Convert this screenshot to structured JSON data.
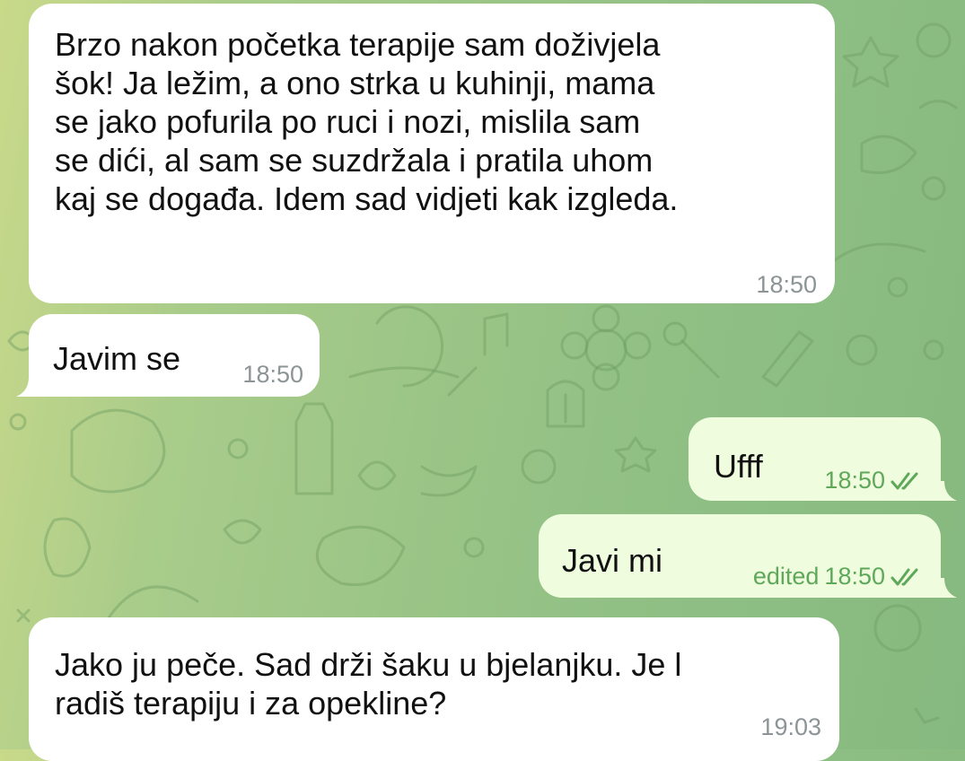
{
  "messages": [
    {
      "direction": "incoming",
      "text": "Brzo nakon početka terapije sam doživjela\nšok! Ja ležim, a ono strka u kuhinji, mama\nse jako pofurila po ruci i nozi, mislila sam\nse dići, al sam se suzdržala i pratila uhom\nkaj se događa. Idem sad vidjeti kak izgleda.",
      "time": "18:50"
    },
    {
      "direction": "incoming",
      "text": "Javim se",
      "time": "18:50"
    },
    {
      "direction": "outgoing",
      "text": "Ufff",
      "time": "18:50",
      "status_icon": "double-check-icon"
    },
    {
      "direction": "outgoing",
      "text": "Javi mi",
      "edited_label": "edited",
      "time": "18:50",
      "status_icon": "double-check-icon"
    },
    {
      "direction": "incoming",
      "text": "Jako ju peče. Sad drži šaku u bjelanjku. Je l\nradiš terapiju i za opekline?",
      "time": "19:03"
    }
  ],
  "colors": {
    "incoming_bubble": "#ffffff",
    "outgoing_bubble": "#effdde",
    "incoming_time": "#8c9496",
    "outgoing_time": "#5fa85a",
    "background_start": "#c9d98a",
    "background_end": "#86b97f"
  }
}
